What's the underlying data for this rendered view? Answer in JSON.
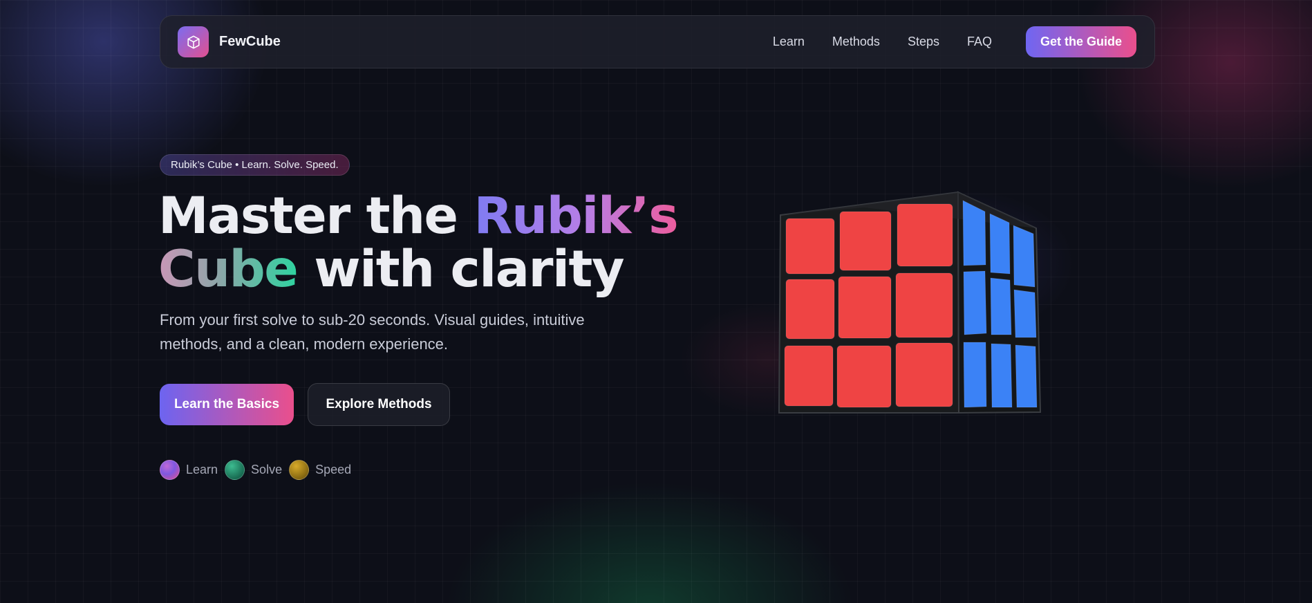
{
  "nav": {
    "brand": "FewCube",
    "links": [
      "Learn",
      "Methods",
      "Steps",
      "FAQ"
    ],
    "cta": "Get the Guide"
  },
  "hero": {
    "badge": "Rubik’s Cube • Learn. Solve. Speed.",
    "headline": {
      "part1": "Master the ",
      "accent1": "Rubik’s",
      "accent2": "Cube",
      "part2": " with clarity"
    },
    "subtitle": "From your first solve to sub-20 seconds. Visual guides, intuitive methods, and a clean, modern experience.",
    "primary_button": "Learn the Basics",
    "secondary_button": "Explore Methods",
    "pills": [
      "Learn",
      "Solve",
      "Speed"
    ]
  },
  "cube": {
    "front_color": "#ef4444",
    "side_color": "#3b82f6"
  },
  "colors": {
    "background": "#0d0f18",
    "accent_start": "#6f66f2",
    "accent_end": "#ea4f8c"
  }
}
